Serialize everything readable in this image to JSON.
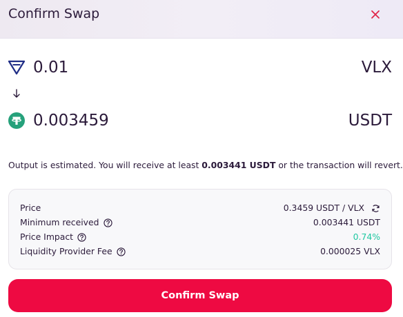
{
  "header": {
    "title": "Confirm Swap",
    "close_icon": "close-icon",
    "close_color": "#e0264a"
  },
  "from": {
    "amount": "0.01",
    "symbol": "VLX",
    "icon": "velas-icon"
  },
  "to": {
    "amount": "0.003459",
    "symbol": "USDT",
    "icon": "tether-icon",
    "icon_color": "#26a17b"
  },
  "estimate": {
    "prefix": "Output is estimated. You will receive at least ",
    "amount": "0.003441 USDT",
    "suffix": " or the transaction will revert."
  },
  "details": {
    "price_label": "Price",
    "price_value": "0.3459 USDT / VLX",
    "min_received_label": "Minimum received",
    "min_received_value": "0.003441 USDT",
    "price_impact_label": "Price Impact",
    "price_impact_value": "0.74%",
    "lp_fee_label": "Liquidity Provider Fee",
    "lp_fee_value": "0.000025 VLX"
  },
  "colors": {
    "accent": "#ee0a42",
    "impact_green": "#1fc7a1",
    "text": "#2b1a3a"
  },
  "confirm_button": {
    "label": "Confirm Swap"
  }
}
